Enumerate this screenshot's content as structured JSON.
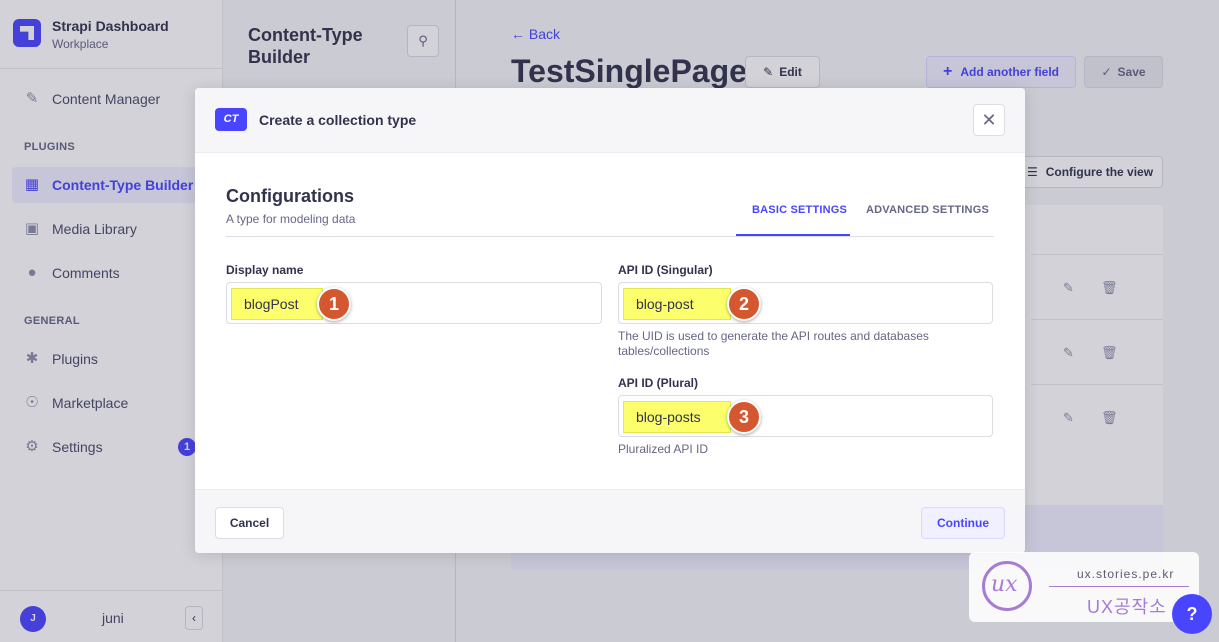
{
  "brand": {
    "name": "Strapi Dashboard",
    "subtitle": "Workplace"
  },
  "nav": {
    "content_manager": "Content Manager",
    "plugins_section": "PLUGINS",
    "content_type_builder": "Content-Type Builder",
    "media_library": "Media Library",
    "comments": "Comments",
    "general_section": "GENERAL",
    "plugins": "Plugins",
    "marketplace": "Marketplace",
    "settings": "Settings",
    "settings_badge": "1"
  },
  "user": {
    "initial": "J",
    "name": "juni"
  },
  "subnav": {
    "title": "Content-Type Builder"
  },
  "main": {
    "back": "Back",
    "page_title": "TestSinglePage",
    "edit": "Edit",
    "add_field": "Add another field",
    "save": "Save",
    "configure_view": "Configure the view"
  },
  "modal": {
    "badge": "CT",
    "title": "Create a collection type",
    "section_title": "Configurations",
    "section_subtitle": "A type for modeling data",
    "tabs": {
      "basic": "BASIC SETTINGS",
      "advanced": "ADVANCED SETTINGS"
    },
    "display_name": {
      "label": "Display name",
      "value": "blogPost",
      "marker": "1"
    },
    "api_singular": {
      "label": "API ID (Singular)",
      "value": "blog-post",
      "marker": "2",
      "hint": "The UID is used to generate the API routes and databases tables/collections"
    },
    "api_plural": {
      "label": "API ID (Plural)",
      "value": "blog-posts",
      "marker": "3",
      "hint": "Pluralized API ID"
    },
    "cancel": "Cancel",
    "continue": "Continue"
  },
  "watermark": {
    "url": "ux.stories.pe.kr",
    "name": "UX공작소"
  },
  "help": "?",
  "colors": {
    "accent": "#4945ff",
    "highlight": "#fcff6b",
    "marker": "#d5572f"
  }
}
